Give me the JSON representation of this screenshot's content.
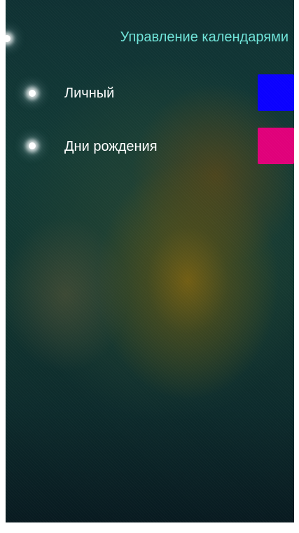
{
  "header": {
    "title": "Управление календарями",
    "icon": "glow-dot-icon"
  },
  "calendars": [
    {
      "label": "Личный",
      "color": "#0a00ff",
      "icon": "glow-dot-icon"
    },
    {
      "label": "Дни рождения",
      "color": "#e0007a",
      "icon": "glow-dot-icon"
    }
  ],
  "theme": {
    "accent_text": "#6fe3d8"
  }
}
